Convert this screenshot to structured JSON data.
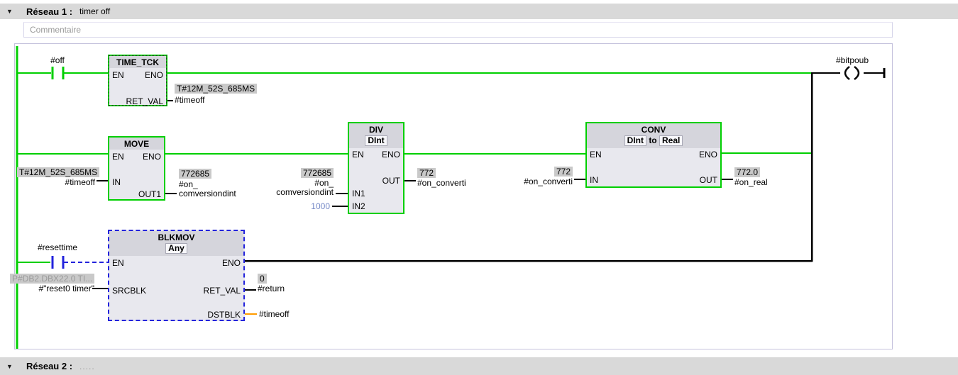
{
  "network1": {
    "collapse_icon": "collapsible-triangle",
    "title": "Réseau 1 :",
    "subtitle": "timer off"
  },
  "comment": {
    "placeholder": "Commentaire"
  },
  "network2": {
    "collapse_icon": "collapsible-triangle",
    "title": "Réseau 2 :",
    "subtitle": "....."
  },
  "colors": {
    "power_flow_green": "#00cf00",
    "interrupted_blue": "#2323dc",
    "dstblk_orange": "#ff9b00",
    "monitor_value_bg": "#c9c9c9",
    "constant_blue": "#7387c6",
    "header_band_gray": "#d9d9d9"
  },
  "contact_off": {
    "label": "#off"
  },
  "contact_resettime": {
    "label": "#resettime"
  },
  "coil": {
    "label": "#bitpoub"
  },
  "time_tck": {
    "title": "TIME_TCK",
    "pin_en": "EN",
    "pin_eno": "ENO",
    "pin_ret_val": "RET_VAL",
    "ret_val_value": "T#12M_52S_685MS",
    "ret_val_operand": "#timeoff"
  },
  "move": {
    "title": "MOVE",
    "pin_en": "EN",
    "pin_eno": "ENO",
    "pin_in": "IN",
    "pin_out1": "OUT1",
    "in_value": "T#12M_52S_685MS",
    "in_operand": "#timeoff",
    "out1_value": "772685",
    "out1_operand_line1": "#on_",
    "out1_operand_line2": "comversiondint"
  },
  "div": {
    "title": "DIV",
    "subtype": "DInt",
    "pin_en": "EN",
    "pin_eno": "ENO",
    "pin_in1": "IN1",
    "pin_in2": "IN2",
    "pin_out": "OUT",
    "in1_value": "772685",
    "in1_operand_line1": "#on_",
    "in1_operand_line2": "comversiondint",
    "in2_value": "1000",
    "out_value": "772",
    "out_operand": "#on_converti"
  },
  "conv": {
    "title": "CONV",
    "subtype_from": "DInt",
    "subtype_word": "to",
    "subtype_to": "Real",
    "pin_en": "EN",
    "pin_eno": "ENO",
    "pin_in": "IN",
    "pin_out": "OUT",
    "in_value": "772",
    "in_operand": "#on_converti",
    "out_value": "772.0",
    "out_operand": "#on_real"
  },
  "blkmov": {
    "title": "BLKMOV",
    "subtype": "Any",
    "pin_en": "EN",
    "pin_eno": "ENO",
    "pin_srcblk": "SRCBLK",
    "pin_ret_val": "RET_VAL",
    "pin_dstblk": "DSTBLK",
    "srcblk_value": "P#DB2.DBX22.0 TI...",
    "srcblk_operand": "#\"reset0 timer\"",
    "ret_val_value": "0",
    "ret_val_operand": "#return",
    "dstblk_operand": "#timeoff"
  }
}
